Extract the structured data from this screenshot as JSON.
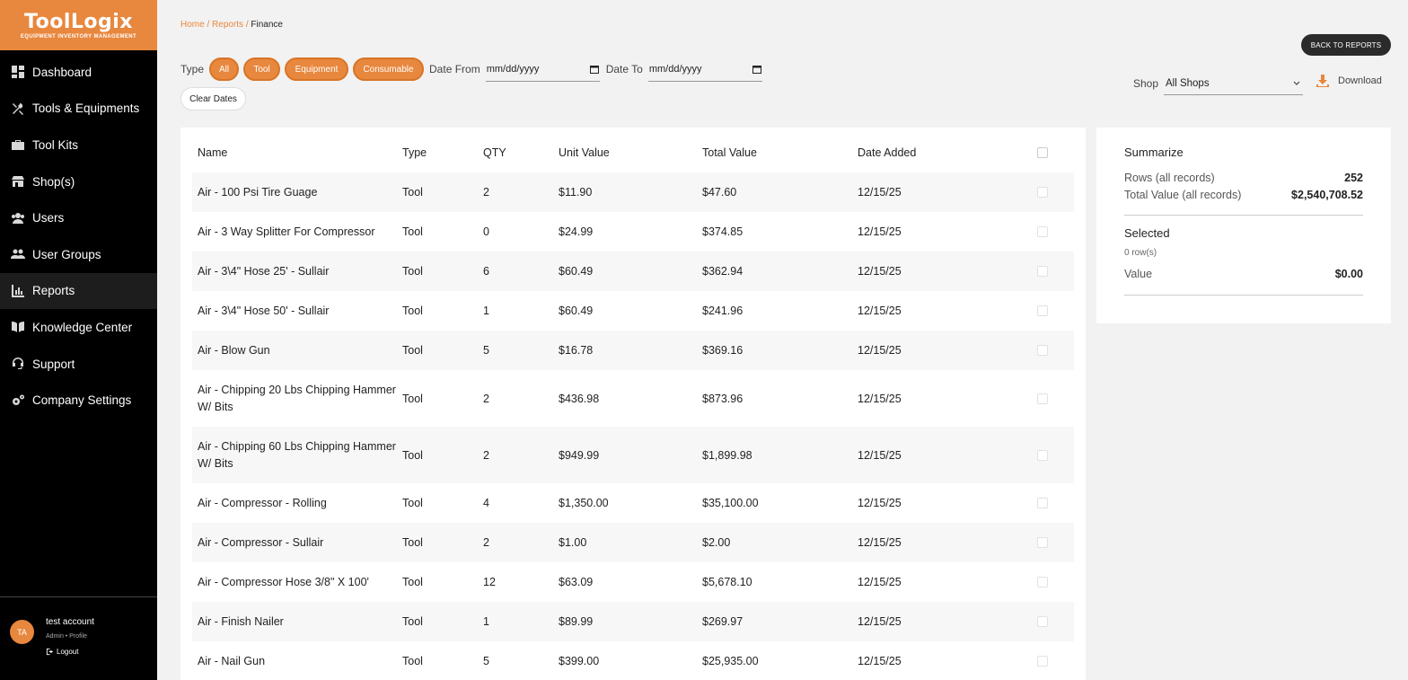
{
  "brand": {
    "name": "ToolLogix",
    "tagline": "EQUIPMENT INVENTORY MANAGEMENT",
    "accent": "#e8873e"
  },
  "sidebar": {
    "items": [
      {
        "label": "Dashboard",
        "icon": "dashboard-icon"
      },
      {
        "label": "Tools & Equipments",
        "icon": "tools-icon"
      },
      {
        "label": "Tool Kits",
        "icon": "toolbox-icon"
      },
      {
        "label": "Shop(s)",
        "icon": "shop-icon"
      },
      {
        "label": "Users",
        "icon": "users-icon"
      },
      {
        "label": "User Groups",
        "icon": "user-groups-icon"
      },
      {
        "label": "Reports",
        "icon": "chart-icon",
        "active": true
      },
      {
        "label": "Knowledge Center",
        "icon": "book-icon"
      },
      {
        "label": "Support",
        "icon": "headset-icon"
      },
      {
        "label": "Company Settings",
        "icon": "gears-icon"
      }
    ],
    "user": {
      "initials": "TA",
      "name": "test account",
      "role": "Admin • Profile",
      "logout": "Logout"
    }
  },
  "breadcrumb": {
    "home": "Home",
    "reports": "Reports",
    "sep": " / ",
    "current": "Finance"
  },
  "header": {
    "back_label": "BACK TO REPORTS"
  },
  "filters": {
    "type_label": "Type",
    "types": [
      "All",
      "Tool",
      "Equipment",
      "Consumable"
    ],
    "date_from_label": "Date From",
    "date_from_placeholder": "mm/dd/yyyy",
    "date_to_label": "Date To",
    "date_to_placeholder": "mm/dd/yyyy",
    "clear_label": "Clear Dates",
    "shop_label": "Shop",
    "shop_value": "All Shops",
    "download_label": "Download"
  },
  "table": {
    "columns": [
      "Name",
      "Type",
      "QTY",
      "Unit Value",
      "Total Value",
      "Date Added"
    ],
    "rows": [
      {
        "name": "Air - 100 Psi Tire Guage",
        "type": "Tool",
        "qty": "2",
        "unit": "$11.90",
        "total": "$47.60",
        "date": "12/15/25"
      },
      {
        "name": "Air - 3 Way Splitter For Compressor",
        "type": "Tool",
        "qty": "0",
        "unit": "$24.99",
        "total": "$374.85",
        "date": "12/15/25"
      },
      {
        "name": "Air - 3\\4\" Hose 25' - Sullair",
        "type": "Tool",
        "qty": "6",
        "unit": "$60.49",
        "total": "$362.94",
        "date": "12/15/25"
      },
      {
        "name": "Air - 3\\4\" Hose 50' - Sullair",
        "type": "Tool",
        "qty": "1",
        "unit": "$60.49",
        "total": "$241.96",
        "date": "12/15/25"
      },
      {
        "name": "Air - Blow Gun",
        "type": "Tool",
        "qty": "5",
        "unit": "$16.78",
        "total": "$369.16",
        "date": "12/15/25"
      },
      {
        "name": "Air - Chipping 20 Lbs Chipping Hammer W/ Bits",
        "type": "Tool",
        "qty": "2",
        "unit": "$436.98",
        "total": "$873.96",
        "date": "12/15/25"
      },
      {
        "name": "Air - Chipping 60 Lbs Chipping Hammer W/ Bits",
        "type": "Tool",
        "qty": "2",
        "unit": "$949.99",
        "total": "$1,899.98",
        "date": "12/15/25"
      },
      {
        "name": "Air - Compressor - Rolling",
        "type": "Tool",
        "qty": "4",
        "unit": "$1,350.00",
        "total": "$35,100.00",
        "date": "12/15/25"
      },
      {
        "name": "Air - Compressor - Sullair",
        "type": "Tool",
        "qty": "2",
        "unit": "$1.00",
        "total": "$2.00",
        "date": "12/15/25"
      },
      {
        "name": "Air - Compressor Hose 3/8\" X 100'",
        "type": "Tool",
        "qty": "12",
        "unit": "$63.09",
        "total": "$5,678.10",
        "date": "12/15/25"
      },
      {
        "name": "Air - Finish Nailer",
        "type": "Tool",
        "qty": "1",
        "unit": "$89.99",
        "total": "$269.97",
        "date": "12/15/25"
      },
      {
        "name": "Air - Nail Gun",
        "type": "Tool",
        "qty": "5",
        "unit": "$399.00",
        "total": "$25,935.00",
        "date": "12/15/25"
      }
    ]
  },
  "summary": {
    "title": "Summarize",
    "rows_label": "Rows (all records)",
    "rows_value": "252",
    "total_label": "Total Value (all records)",
    "total_value": "$2,540,708.52",
    "selected_title": "Selected",
    "selected_count": "0 row(s)",
    "value_label": "Value",
    "value_value": "$0.00"
  }
}
